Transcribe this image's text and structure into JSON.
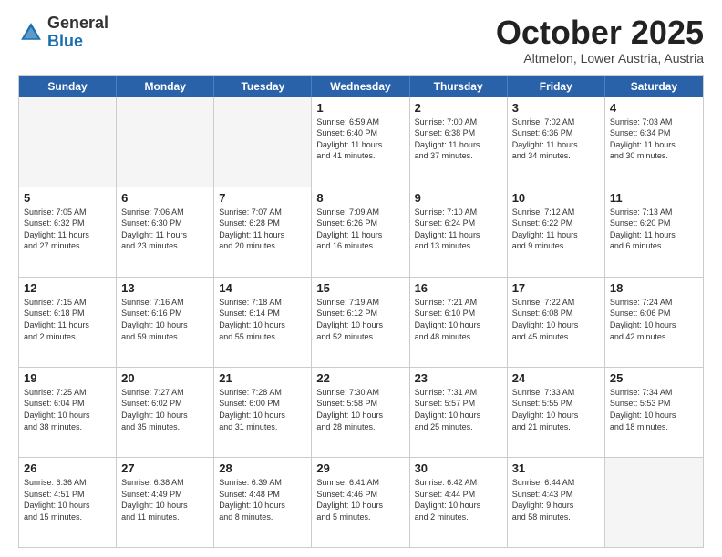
{
  "header": {
    "logo_line1": "General",
    "logo_line2": "Blue",
    "month": "October 2025",
    "location": "Altmelon, Lower Austria, Austria"
  },
  "weekdays": [
    "Sunday",
    "Monday",
    "Tuesday",
    "Wednesday",
    "Thursday",
    "Friday",
    "Saturday"
  ],
  "weeks": [
    [
      {
        "day": "",
        "info": ""
      },
      {
        "day": "",
        "info": ""
      },
      {
        "day": "",
        "info": ""
      },
      {
        "day": "1",
        "info": "Sunrise: 6:59 AM\nSunset: 6:40 PM\nDaylight: 11 hours\nand 41 minutes."
      },
      {
        "day": "2",
        "info": "Sunrise: 7:00 AM\nSunset: 6:38 PM\nDaylight: 11 hours\nand 37 minutes."
      },
      {
        "day": "3",
        "info": "Sunrise: 7:02 AM\nSunset: 6:36 PM\nDaylight: 11 hours\nand 34 minutes."
      },
      {
        "day": "4",
        "info": "Sunrise: 7:03 AM\nSunset: 6:34 PM\nDaylight: 11 hours\nand 30 minutes."
      }
    ],
    [
      {
        "day": "5",
        "info": "Sunrise: 7:05 AM\nSunset: 6:32 PM\nDaylight: 11 hours\nand 27 minutes."
      },
      {
        "day": "6",
        "info": "Sunrise: 7:06 AM\nSunset: 6:30 PM\nDaylight: 11 hours\nand 23 minutes."
      },
      {
        "day": "7",
        "info": "Sunrise: 7:07 AM\nSunset: 6:28 PM\nDaylight: 11 hours\nand 20 minutes."
      },
      {
        "day": "8",
        "info": "Sunrise: 7:09 AM\nSunset: 6:26 PM\nDaylight: 11 hours\nand 16 minutes."
      },
      {
        "day": "9",
        "info": "Sunrise: 7:10 AM\nSunset: 6:24 PM\nDaylight: 11 hours\nand 13 minutes."
      },
      {
        "day": "10",
        "info": "Sunrise: 7:12 AM\nSunset: 6:22 PM\nDaylight: 11 hours\nand 9 minutes."
      },
      {
        "day": "11",
        "info": "Sunrise: 7:13 AM\nSunset: 6:20 PM\nDaylight: 11 hours\nand 6 minutes."
      }
    ],
    [
      {
        "day": "12",
        "info": "Sunrise: 7:15 AM\nSunset: 6:18 PM\nDaylight: 11 hours\nand 2 minutes."
      },
      {
        "day": "13",
        "info": "Sunrise: 7:16 AM\nSunset: 6:16 PM\nDaylight: 10 hours\nand 59 minutes."
      },
      {
        "day": "14",
        "info": "Sunrise: 7:18 AM\nSunset: 6:14 PM\nDaylight: 10 hours\nand 55 minutes."
      },
      {
        "day": "15",
        "info": "Sunrise: 7:19 AM\nSunset: 6:12 PM\nDaylight: 10 hours\nand 52 minutes."
      },
      {
        "day": "16",
        "info": "Sunrise: 7:21 AM\nSunset: 6:10 PM\nDaylight: 10 hours\nand 48 minutes."
      },
      {
        "day": "17",
        "info": "Sunrise: 7:22 AM\nSunset: 6:08 PM\nDaylight: 10 hours\nand 45 minutes."
      },
      {
        "day": "18",
        "info": "Sunrise: 7:24 AM\nSunset: 6:06 PM\nDaylight: 10 hours\nand 42 minutes."
      }
    ],
    [
      {
        "day": "19",
        "info": "Sunrise: 7:25 AM\nSunset: 6:04 PM\nDaylight: 10 hours\nand 38 minutes."
      },
      {
        "day": "20",
        "info": "Sunrise: 7:27 AM\nSunset: 6:02 PM\nDaylight: 10 hours\nand 35 minutes."
      },
      {
        "day": "21",
        "info": "Sunrise: 7:28 AM\nSunset: 6:00 PM\nDaylight: 10 hours\nand 31 minutes."
      },
      {
        "day": "22",
        "info": "Sunrise: 7:30 AM\nSunset: 5:58 PM\nDaylight: 10 hours\nand 28 minutes."
      },
      {
        "day": "23",
        "info": "Sunrise: 7:31 AM\nSunset: 5:57 PM\nDaylight: 10 hours\nand 25 minutes."
      },
      {
        "day": "24",
        "info": "Sunrise: 7:33 AM\nSunset: 5:55 PM\nDaylight: 10 hours\nand 21 minutes."
      },
      {
        "day": "25",
        "info": "Sunrise: 7:34 AM\nSunset: 5:53 PM\nDaylight: 10 hours\nand 18 minutes."
      }
    ],
    [
      {
        "day": "26",
        "info": "Sunrise: 6:36 AM\nSunset: 4:51 PM\nDaylight: 10 hours\nand 15 minutes."
      },
      {
        "day": "27",
        "info": "Sunrise: 6:38 AM\nSunset: 4:49 PM\nDaylight: 10 hours\nand 11 minutes."
      },
      {
        "day": "28",
        "info": "Sunrise: 6:39 AM\nSunset: 4:48 PM\nDaylight: 10 hours\nand 8 minutes."
      },
      {
        "day": "29",
        "info": "Sunrise: 6:41 AM\nSunset: 4:46 PM\nDaylight: 10 hours\nand 5 minutes."
      },
      {
        "day": "30",
        "info": "Sunrise: 6:42 AM\nSunset: 4:44 PM\nDaylight: 10 hours\nand 2 minutes."
      },
      {
        "day": "31",
        "info": "Sunrise: 6:44 AM\nSunset: 4:43 PM\nDaylight: 9 hours\nand 58 minutes."
      },
      {
        "day": "",
        "info": ""
      }
    ]
  ]
}
